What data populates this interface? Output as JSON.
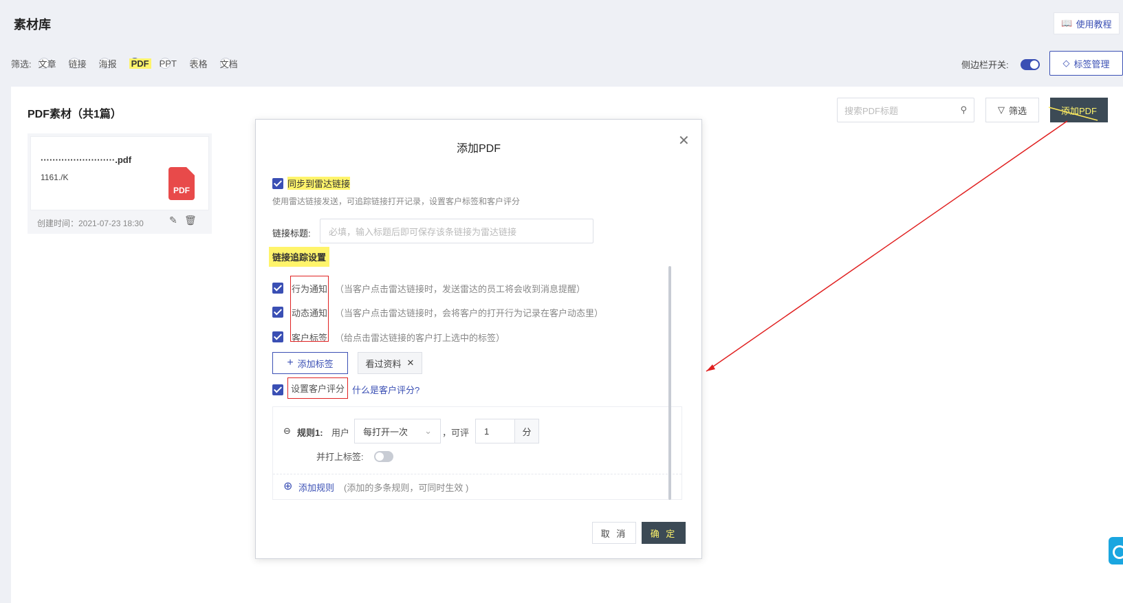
{
  "header": {
    "title": "素材库",
    "tutorial_label": "使用教程"
  },
  "filter": {
    "label": "筛选:",
    "options": [
      "文章",
      "链接",
      "海报",
      "PDF",
      "PPT",
      "表格",
      "文档"
    ],
    "selected": "PDF",
    "sidebar_toggle_label": "侧边栏开关:",
    "tag_manage_label": "标签管理"
  },
  "main": {
    "section_title": "PDF素材（共1篇）",
    "search_placeholder": "搜索PDF标题",
    "filter_button": "筛选",
    "add_pdf_button": "添加PDF",
    "card": {
      "name": "·························.pdf",
      "size": "1161./K",
      "icon_text": "PDF",
      "created": "创建时间：2021-07-23 18:30"
    }
  },
  "modal": {
    "title": "添加PDF",
    "sync_label": "同步到雷达链接",
    "sync_desc": "使用雷达链接发送，可追踪链接打开记录，设置客户标签和客户评分",
    "link_title_label": "链接标题:",
    "link_title_placeholder": "必填，输入标题后即可保存该条链接为雷达链接",
    "tracking_heading": "链接追踪设置",
    "behavior_label": "行为通知",
    "behavior_desc": "（当客户点击雷达链接时，发送雷达的员工将会收到消息提醒）",
    "dynamic_label": "动态通知",
    "dynamic_desc": "（当客户点击雷达链接时，会将客户的打开行为记录在客户动态里）",
    "customer_tag_label": "客户标签",
    "customer_tag_desc": "（给点击雷达链接的客户打上选中的标签）",
    "add_tag_button": "添加标签",
    "tag_chip": "看过资料",
    "score_label": "设置客户评分",
    "score_help_link": "什么是客户评分?",
    "rule_label": "规则1:",
    "rule_user": "用户",
    "rule_select": "每打开一次",
    "rule_can_score": "，可评",
    "rule_value": "1",
    "rule_unit": "分",
    "rule_tag_label": "并打上标签:",
    "add_rule_link": "添加规则",
    "add_rule_desc": "(添加的多条规则，可同时生效 )",
    "cancel_button": "取 消",
    "ok_button": "确 定"
  },
  "colors": {
    "accent": "#3a4fb4",
    "highlight": "#fff46b",
    "dark_button": "#3c4a55",
    "annotation": "#e02020"
  }
}
